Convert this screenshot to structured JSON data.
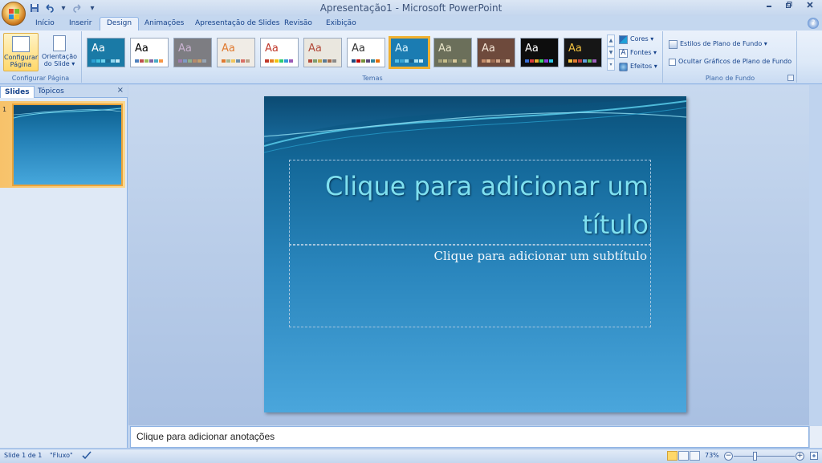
{
  "window": {
    "title": "Apresentação1 - Microsoft PowerPoint",
    "controls": [
      "minimize-icon",
      "restore-icon",
      "close-icon"
    ]
  },
  "quick_access": [
    "save-icon",
    "undo-icon",
    "redo-icon",
    "customize-icon"
  ],
  "tabs": [
    {
      "label": "Início"
    },
    {
      "label": "Inserir"
    },
    {
      "label": "Design",
      "active": true
    },
    {
      "label": "Animações"
    },
    {
      "label": "Apresentação de Slides"
    },
    {
      "label": "Revisão"
    },
    {
      "label": "Exibição"
    }
  ],
  "ribbon": {
    "configurar_pagina": {
      "group_label": "Configurar Página",
      "page_setup_label_1": "Configurar",
      "page_setup_label_2": "Página",
      "orientation_label_1": "Orientação",
      "orientation_label_2": "do Slide ▾"
    },
    "temas": {
      "group_label": "Temas",
      "theme_label": "Aa",
      "themes": [
        {
          "bg": "#1a7aa6",
          "fg": "#ffffff",
          "swatches": [
            "#2b9fd4",
            "#3fc0e0",
            "#6ed2ee",
            "#1c6b92",
            "#8fd7f0",
            "#c6e9f5"
          ]
        },
        {
          "bg": "#ffffff",
          "fg": "#000000",
          "swatches": [
            "#4f81bd",
            "#c0504d",
            "#9bbb59",
            "#8064a2",
            "#4bacc6",
            "#f79646"
          ]
        },
        {
          "bg": "#7d7d82",
          "fg": "#c9b2d0",
          "swatches": [
            "#a07db0",
            "#7f9bc4",
            "#8fb08d",
            "#b88a6a",
            "#c5a06e",
            "#97a6b6"
          ]
        },
        {
          "bg": "#f0ece6",
          "fg": "#e07a30",
          "swatches": [
            "#e07a30",
            "#a5b592",
            "#f2c55c",
            "#6f8ea9",
            "#d97066",
            "#b9a38a"
          ]
        },
        {
          "bg": "#ffffff",
          "fg": "#c0392b",
          "swatches": [
            "#c0392b",
            "#e67e22",
            "#f1c40f",
            "#2ecc71",
            "#3498db",
            "#9b59b6"
          ]
        },
        {
          "bg": "#eae7df",
          "fg": "#b24a3a",
          "swatches": [
            "#b24a3a",
            "#7d9d72",
            "#c9a645",
            "#5b7b94",
            "#a2694c",
            "#8a8a8a"
          ]
        },
        {
          "bg": "#ffffff",
          "fg": "#333333",
          "swatches": [
            "#1f497d",
            "#c00000",
            "#76923c",
            "#5f497a",
            "#31859c",
            "#e36c09"
          ]
        },
        {
          "bg": "#1b7cb2",
          "fg": "#d5f1fb",
          "swatches": [
            "#58c1e8",
            "#3aa6d6",
            "#8bd8f2",
            "#1c5f8a",
            "#a7e2f4",
            "#cdeef8"
          ],
          "selected": true
        },
        {
          "bg": "#6b6f5a",
          "fg": "#e8e4c8",
          "swatches": [
            "#a6a27a",
            "#c7be8a",
            "#8a8c6f",
            "#d8c89a",
            "#6e7a5c",
            "#b7aa82"
          ]
        },
        {
          "bg": "#6e4a3c",
          "fg": "#f3e4d4",
          "swatches": [
            "#c58c6a",
            "#e0b48e",
            "#9e6c52",
            "#d4a78a",
            "#7b5c4c",
            "#eacbb0"
          ]
        },
        {
          "bg": "#0d0d0d",
          "fg": "#ffffff",
          "swatches": [
            "#3a6fd8",
            "#d83a3a",
            "#e8b030",
            "#3ad86a",
            "#8a3ad8",
            "#30c8e8"
          ]
        },
        {
          "bg": "#161616",
          "fg": "#f0c040",
          "swatches": [
            "#f0c040",
            "#e07a30",
            "#c04040",
            "#60a0e0",
            "#60c060",
            "#a060c0"
          ]
        }
      ]
    },
    "theme_options": {
      "cores": "Cores ▾",
      "fontes": "Fontes ▾",
      "efeitos": "Efeitos ▾"
    },
    "plano_de_fundo": {
      "group_label": "Plano de Fundo",
      "estilos": "Estilos de Plano de Fundo ▾",
      "ocultar": "Ocultar Gráficos de Plano de Fundo",
      "ocultar_checked": false
    }
  },
  "left_pane": {
    "tabs": [
      "Slides",
      "Tópicos"
    ],
    "close": "×",
    "slide_number": "1"
  },
  "slide": {
    "title_placeholder": "Clique para adicionar um título",
    "subtitle_placeholder": "Clique para adicionar um subtítulo"
  },
  "notes": {
    "placeholder": "Clique para adicionar anotações"
  },
  "status": {
    "slide_info": "Slide 1 de 1",
    "theme_name": "\"Fluxo\"",
    "zoom": "73%",
    "zoom_level_percent": 73
  }
}
